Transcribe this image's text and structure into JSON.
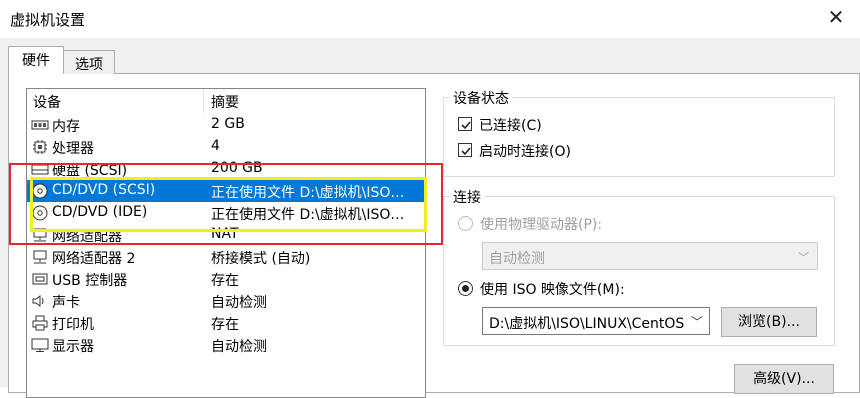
{
  "window": {
    "title": "虚拟机设置",
    "close_glyph": "✕"
  },
  "tabs": [
    {
      "label": "硬件"
    },
    {
      "label": "选项"
    }
  ],
  "device_list": {
    "columns": [
      "设备",
      "摘要"
    ],
    "rows": [
      {
        "name": "内存",
        "summary": "2 GB",
        "icon": "memory-icon"
      },
      {
        "name": "处理器",
        "summary": "4",
        "icon": "processor-icon"
      },
      {
        "name": "硬盘 (SCSI)",
        "summary": "200 GB",
        "icon": "hard-disk-icon"
      },
      {
        "name": "CD/DVD (SCSI)",
        "summary": "正在使用文件 D:\\虚拟机\\ISO…",
        "icon": "cd-dvd-icon",
        "selected": true
      },
      {
        "name": "CD/DVD (IDE)",
        "summary": "正在使用文件 D:\\虚拟机\\ISO…",
        "icon": "cd-dvd-icon"
      },
      {
        "name": "网络适配器",
        "summary": "NAT",
        "icon": "network-adapter-icon"
      },
      {
        "name": "网络适配器 2",
        "summary": "桥接模式 (自动)",
        "icon": "network-adapter-icon"
      },
      {
        "name": "USB 控制器",
        "summary": "存在",
        "icon": "usb-icon"
      },
      {
        "name": "声卡",
        "summary": "自动检测",
        "icon": "speaker-icon"
      },
      {
        "name": "打印机",
        "summary": "存在",
        "icon": "printer-icon"
      },
      {
        "name": "显示器",
        "summary": "自动检测",
        "icon": "monitor-icon"
      }
    ]
  },
  "device_status": {
    "legend": "设备状态",
    "connected_label": "已连接(C)",
    "connect_at_power_on_label": "启动时连接(O)",
    "connected": true,
    "connect_at_power_on": true
  },
  "connection": {
    "legend": "连接",
    "physical_drive_label": "使用物理驱动器(P):",
    "physical_drive_value": "自动检测",
    "iso_label": "使用 ISO 映像文件(M):",
    "iso_path": "D:\\虚拟机\\ISO\\LINUX\\CentOS",
    "browse_label": "浏览(B)...",
    "selected_mode": "iso"
  },
  "advanced_label": "高级(V)...",
  "colors": {
    "selection": "#0078d7",
    "highlight_red": "#e8262f",
    "highlight_yellow": "#f2f018"
  }
}
